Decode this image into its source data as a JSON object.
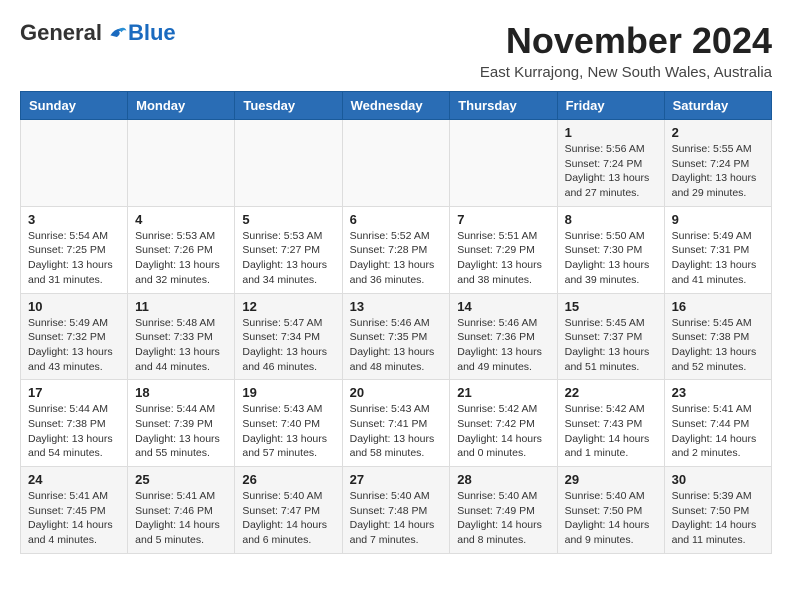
{
  "header": {
    "logo_general": "General",
    "logo_blue": "Blue",
    "month_title": "November 2024",
    "location": "East Kurrajong, New South Wales, Australia"
  },
  "weekdays": [
    "Sunday",
    "Monday",
    "Tuesday",
    "Wednesday",
    "Thursday",
    "Friday",
    "Saturday"
  ],
  "weeks": [
    [
      {
        "day": "",
        "info": ""
      },
      {
        "day": "",
        "info": ""
      },
      {
        "day": "",
        "info": ""
      },
      {
        "day": "",
        "info": ""
      },
      {
        "day": "",
        "info": ""
      },
      {
        "day": "1",
        "info": "Sunrise: 5:56 AM\nSunset: 7:24 PM\nDaylight: 13 hours\nand 27 minutes."
      },
      {
        "day": "2",
        "info": "Sunrise: 5:55 AM\nSunset: 7:24 PM\nDaylight: 13 hours\nand 29 minutes."
      }
    ],
    [
      {
        "day": "3",
        "info": "Sunrise: 5:54 AM\nSunset: 7:25 PM\nDaylight: 13 hours\nand 31 minutes."
      },
      {
        "day": "4",
        "info": "Sunrise: 5:53 AM\nSunset: 7:26 PM\nDaylight: 13 hours\nand 32 minutes."
      },
      {
        "day": "5",
        "info": "Sunrise: 5:53 AM\nSunset: 7:27 PM\nDaylight: 13 hours\nand 34 minutes."
      },
      {
        "day": "6",
        "info": "Sunrise: 5:52 AM\nSunset: 7:28 PM\nDaylight: 13 hours\nand 36 minutes."
      },
      {
        "day": "7",
        "info": "Sunrise: 5:51 AM\nSunset: 7:29 PM\nDaylight: 13 hours\nand 38 minutes."
      },
      {
        "day": "8",
        "info": "Sunrise: 5:50 AM\nSunset: 7:30 PM\nDaylight: 13 hours\nand 39 minutes."
      },
      {
        "day": "9",
        "info": "Sunrise: 5:49 AM\nSunset: 7:31 PM\nDaylight: 13 hours\nand 41 minutes."
      }
    ],
    [
      {
        "day": "10",
        "info": "Sunrise: 5:49 AM\nSunset: 7:32 PM\nDaylight: 13 hours\nand 43 minutes."
      },
      {
        "day": "11",
        "info": "Sunrise: 5:48 AM\nSunset: 7:33 PM\nDaylight: 13 hours\nand 44 minutes."
      },
      {
        "day": "12",
        "info": "Sunrise: 5:47 AM\nSunset: 7:34 PM\nDaylight: 13 hours\nand 46 minutes."
      },
      {
        "day": "13",
        "info": "Sunrise: 5:46 AM\nSunset: 7:35 PM\nDaylight: 13 hours\nand 48 minutes."
      },
      {
        "day": "14",
        "info": "Sunrise: 5:46 AM\nSunset: 7:36 PM\nDaylight: 13 hours\nand 49 minutes."
      },
      {
        "day": "15",
        "info": "Sunrise: 5:45 AM\nSunset: 7:37 PM\nDaylight: 13 hours\nand 51 minutes."
      },
      {
        "day": "16",
        "info": "Sunrise: 5:45 AM\nSunset: 7:38 PM\nDaylight: 13 hours\nand 52 minutes."
      }
    ],
    [
      {
        "day": "17",
        "info": "Sunrise: 5:44 AM\nSunset: 7:38 PM\nDaylight: 13 hours\nand 54 minutes."
      },
      {
        "day": "18",
        "info": "Sunrise: 5:44 AM\nSunset: 7:39 PM\nDaylight: 13 hours\nand 55 minutes."
      },
      {
        "day": "19",
        "info": "Sunrise: 5:43 AM\nSunset: 7:40 PM\nDaylight: 13 hours\nand 57 minutes."
      },
      {
        "day": "20",
        "info": "Sunrise: 5:43 AM\nSunset: 7:41 PM\nDaylight: 13 hours\nand 58 minutes."
      },
      {
        "day": "21",
        "info": "Sunrise: 5:42 AM\nSunset: 7:42 PM\nDaylight: 14 hours\nand 0 minutes."
      },
      {
        "day": "22",
        "info": "Sunrise: 5:42 AM\nSunset: 7:43 PM\nDaylight: 14 hours\nand 1 minute."
      },
      {
        "day": "23",
        "info": "Sunrise: 5:41 AM\nSunset: 7:44 PM\nDaylight: 14 hours\nand 2 minutes."
      }
    ],
    [
      {
        "day": "24",
        "info": "Sunrise: 5:41 AM\nSunset: 7:45 PM\nDaylight: 14 hours\nand 4 minutes."
      },
      {
        "day": "25",
        "info": "Sunrise: 5:41 AM\nSunset: 7:46 PM\nDaylight: 14 hours\nand 5 minutes."
      },
      {
        "day": "26",
        "info": "Sunrise: 5:40 AM\nSunset: 7:47 PM\nDaylight: 14 hours\nand 6 minutes."
      },
      {
        "day": "27",
        "info": "Sunrise: 5:40 AM\nSunset: 7:48 PM\nDaylight: 14 hours\nand 7 minutes."
      },
      {
        "day": "28",
        "info": "Sunrise: 5:40 AM\nSunset: 7:49 PM\nDaylight: 14 hours\nand 8 minutes."
      },
      {
        "day": "29",
        "info": "Sunrise: 5:40 AM\nSunset: 7:50 PM\nDaylight: 14 hours\nand 9 minutes."
      },
      {
        "day": "30",
        "info": "Sunrise: 5:39 AM\nSunset: 7:50 PM\nDaylight: 14 hours\nand 11 minutes."
      }
    ]
  ]
}
